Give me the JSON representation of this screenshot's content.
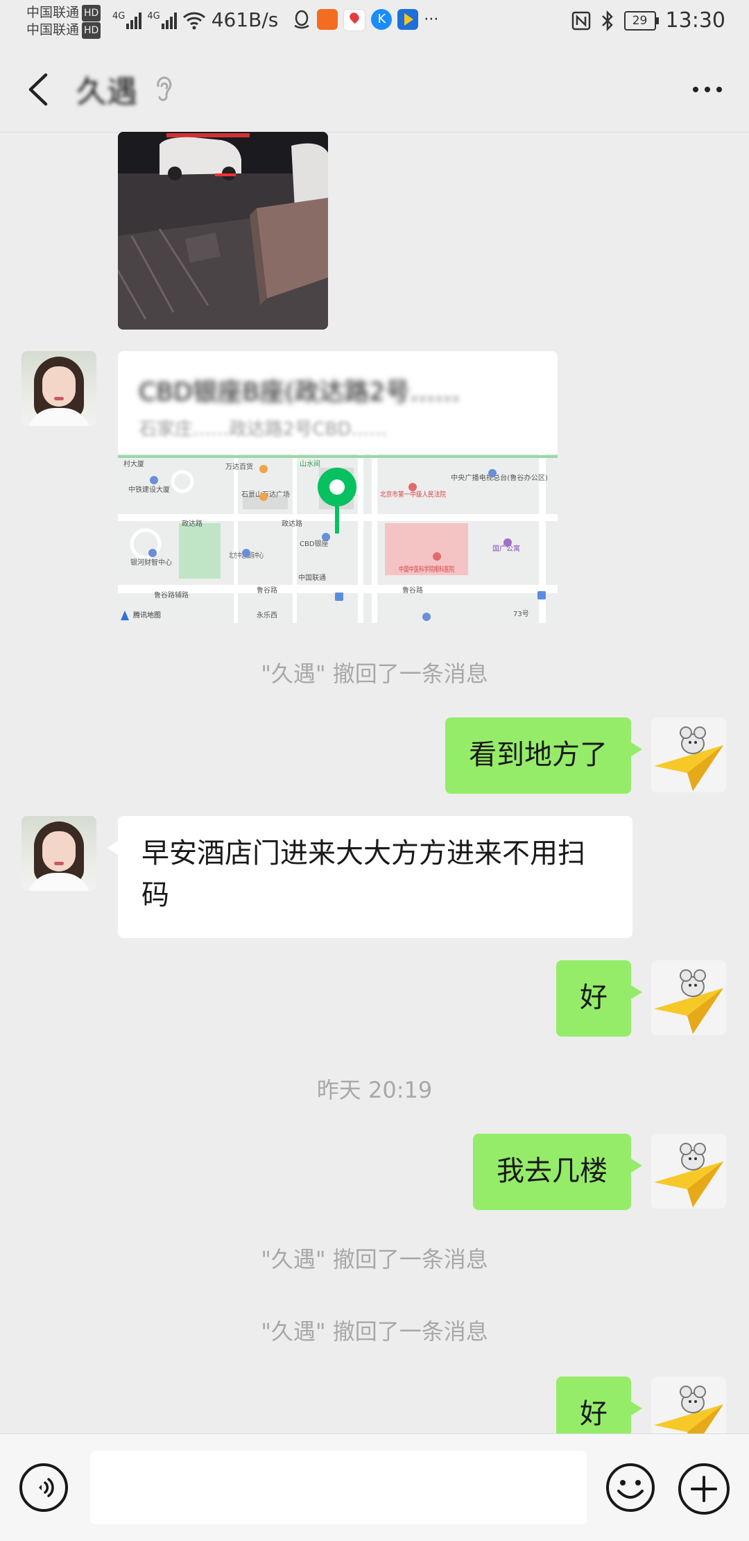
{
  "status_bar": {
    "carrier_1": "中国联通",
    "carrier_2": "中国联通",
    "hd": "HD",
    "net_type": "4G",
    "net_speed": "461B/s",
    "more_icons": "···",
    "battery": "29",
    "time": "13:30"
  },
  "header": {
    "title": "久遇"
  },
  "location_card": {
    "name": "CBD银座B座(政达路2号……",
    "address": "石家庄……政达路2号CBD……",
    "map_labels": {
      "shanshui": "山水间",
      "wanda_baihuo": "万达百货",
      "zhongtie": "中铁建设大厦",
      "court": "北京市第一中级人民法院",
      "cctv": "中央广播电视总台(鲁谷办公区)",
      "wanda_plaza": "石景山万达广场",
      "zhengda_rd": "政达路",
      "cbd_yinzuo": "CBD银座",
      "yinhe": "银河财智中心",
      "beifang": "北方中惠国际中心",
      "hospital": "中国中医科学院眼科医院",
      "guoguang": "国广公寓",
      "unicom": "中国联通",
      "lugu_rd": "鲁谷路",
      "lugu_fu": "鲁谷路辅路",
      "tencent": "腾讯地图",
      "yonglexi": "永乐西",
      "no73": "73号"
    }
  },
  "messages": {
    "recall_1": "\"久遇\" 撤回了一条消息",
    "msg_seen": "看到地方了",
    "msg_hotel": "早安酒店门进来大大方方进来不用扫码",
    "msg_ok_1": "好",
    "timestamp": "昨天 20:19",
    "msg_floor": "我去几楼",
    "recall_2": "\"久遇\" 撤回了一条消息",
    "recall_3": "\"久遇\" 撤回了一条消息",
    "msg_ok_2": "好"
  },
  "colors": {
    "sent_bubble": "#95ec69",
    "received_bubble": "#ffffff",
    "background": "#ededed",
    "map_pin": "#07c160"
  },
  "icons": {
    "back": "chevron-left-icon",
    "ear": "ear-icon",
    "more": "more-icon",
    "voice": "voice-icon",
    "emoji": "emoji-icon",
    "plus": "plus-icon"
  }
}
